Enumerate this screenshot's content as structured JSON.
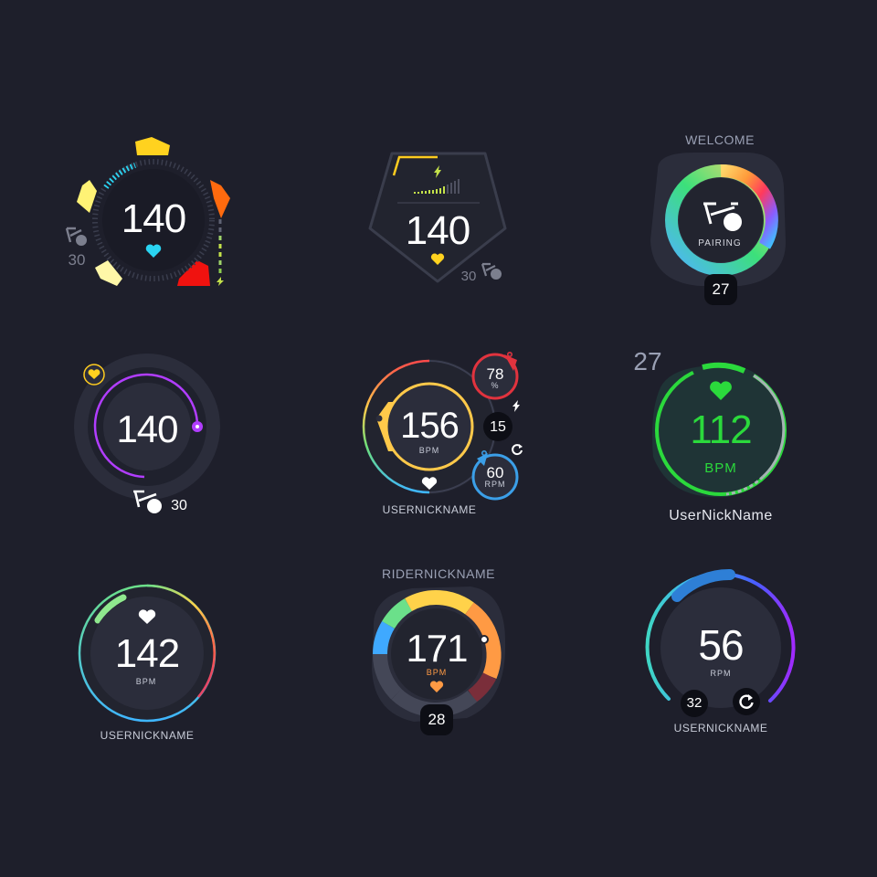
{
  "palette": {
    "background": "#1e1f2b",
    "panel": "#2b2d3b",
    "heart_cyan": "#2ad4f2",
    "heart_yellow": "#ffd21f",
    "green": "#2bd93c",
    "purple": "#b13dff",
    "blue": "#3b9fe8",
    "red": "#e1333e"
  },
  "widgets": [
    {
      "value": "140",
      "side_value": "30",
      "icons": [
        "bike-icon",
        "heart-icon",
        "bolt-icon"
      ]
    },
    {
      "value": "140",
      "side_value": "30",
      "icons": [
        "bolt-icon",
        "heart-icon",
        "bike-icon"
      ]
    },
    {
      "header": "WELCOME",
      "status": "PAIRING",
      "badge": "27",
      "icons": [
        "bike-icon"
      ]
    },
    {
      "value": "140",
      "side_value": "30",
      "icons": [
        "heart-icon",
        "bike-icon"
      ]
    },
    {
      "value": "156",
      "unit": "BPM",
      "percent_value": "78",
      "percent_unit": "%",
      "center_badge": "15",
      "rpm_value": "60",
      "rpm_unit": "RPM",
      "nickname": "USERNICKNAME",
      "icons": [
        "heart-icon",
        "bolt-icon",
        "refresh-icon"
      ]
    },
    {
      "corner_value": "27",
      "value": "112",
      "unit": "BPM",
      "nickname": "UserNickName",
      "icons": [
        "heart-icon"
      ]
    },
    {
      "value": "142",
      "unit": "BPM",
      "nickname": "USERNICKNAME",
      "icons": [
        "heart-icon"
      ]
    },
    {
      "header": "RIDERNICKNAME",
      "value": "171",
      "unit": "BPM",
      "badge": "28",
      "icons": [
        "heart-icon"
      ]
    },
    {
      "value": "56",
      "unit": "RPM",
      "left_badge": "32",
      "nickname": "USERNICKNAME",
      "icons": [
        "refresh-icon"
      ]
    }
  ]
}
